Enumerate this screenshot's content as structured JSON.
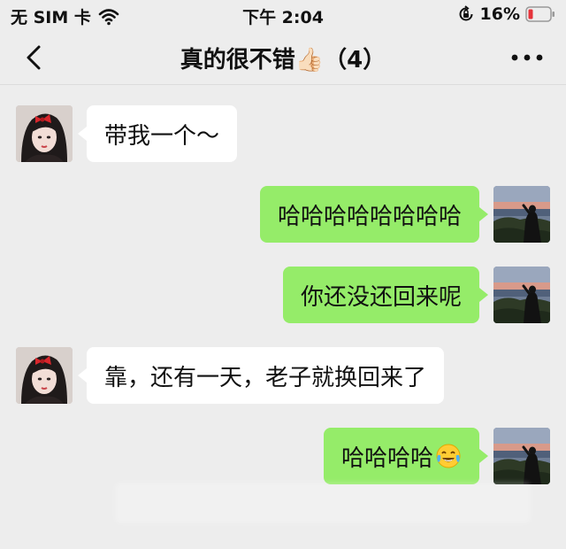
{
  "status": {
    "carrier": "无 SIM 卡",
    "time": "下午 2:04",
    "battery": "16%"
  },
  "nav": {
    "title": "真的很不错👍🏻（4）"
  },
  "messages": [
    {
      "side": "in",
      "text": "带我一个～"
    },
    {
      "side": "out",
      "text": "哈哈哈哈哈哈哈哈"
    },
    {
      "side": "out",
      "text": "你还没还回来呢"
    },
    {
      "side": "in",
      "text": "靠，还有一天，老子就换回来了"
    },
    {
      "side": "out",
      "text": "哈哈哈哈",
      "emoji": "tears-of-joy-emoji"
    }
  ],
  "colors": {
    "background": "#ededed",
    "outgoing_bubble": "#95ec69",
    "incoming_bubble": "#ffffff",
    "battery_low": "#e5333a"
  },
  "icons": {
    "back": "chevron-left-icon",
    "more": "more-dots-icon",
    "wifi": "wifi-icon",
    "orientation_lock": "orientation-lock-icon",
    "battery": "battery-low-icon"
  }
}
